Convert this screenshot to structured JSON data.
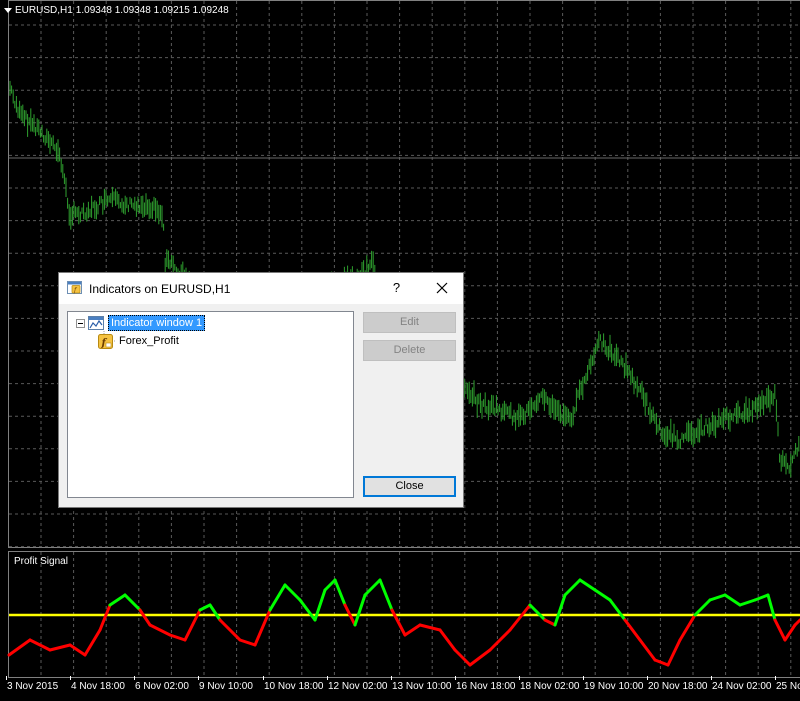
{
  "chart": {
    "header": {
      "symbol": "EURUSD,H1",
      "ohlc": "1.09348 1.09348 1.09215 1.09248"
    },
    "subwindow_title": "Profit Signal",
    "time_labels": [
      "3 Nov 2015",
      "4 Nov 18:00",
      "6 Nov 02:00",
      "9 Nov 10:00",
      "10 Nov 18:00",
      "12 Nov 02:00",
      "13 Nov 10:00",
      "16 Nov 18:00",
      "18 Nov 02:00",
      "19 Nov 10:00",
      "20 Nov 18:00",
      "24 Nov 02:00",
      "25 No"
    ],
    "colors": {
      "background": "#000000",
      "grid": "#5a5a5a",
      "price_bars": "#2fa12f",
      "signal_up": "#00ff00",
      "signal_down": "#ff0000",
      "signal_level": "#ffff00"
    }
  },
  "dialog": {
    "title": "Indicators on EURUSD,H1",
    "help_label": "?",
    "tree": {
      "window_label": "Indicator window 1",
      "indicator_label": "Forex_Profit"
    },
    "buttons": {
      "edit": "Edit",
      "delete": "Delete",
      "close": "Close"
    },
    "icons": {
      "title": "indicators-icon",
      "window": "indicator-window-icon",
      "indicator": "custom-indicator-icon",
      "close": "close-icon"
    }
  }
}
